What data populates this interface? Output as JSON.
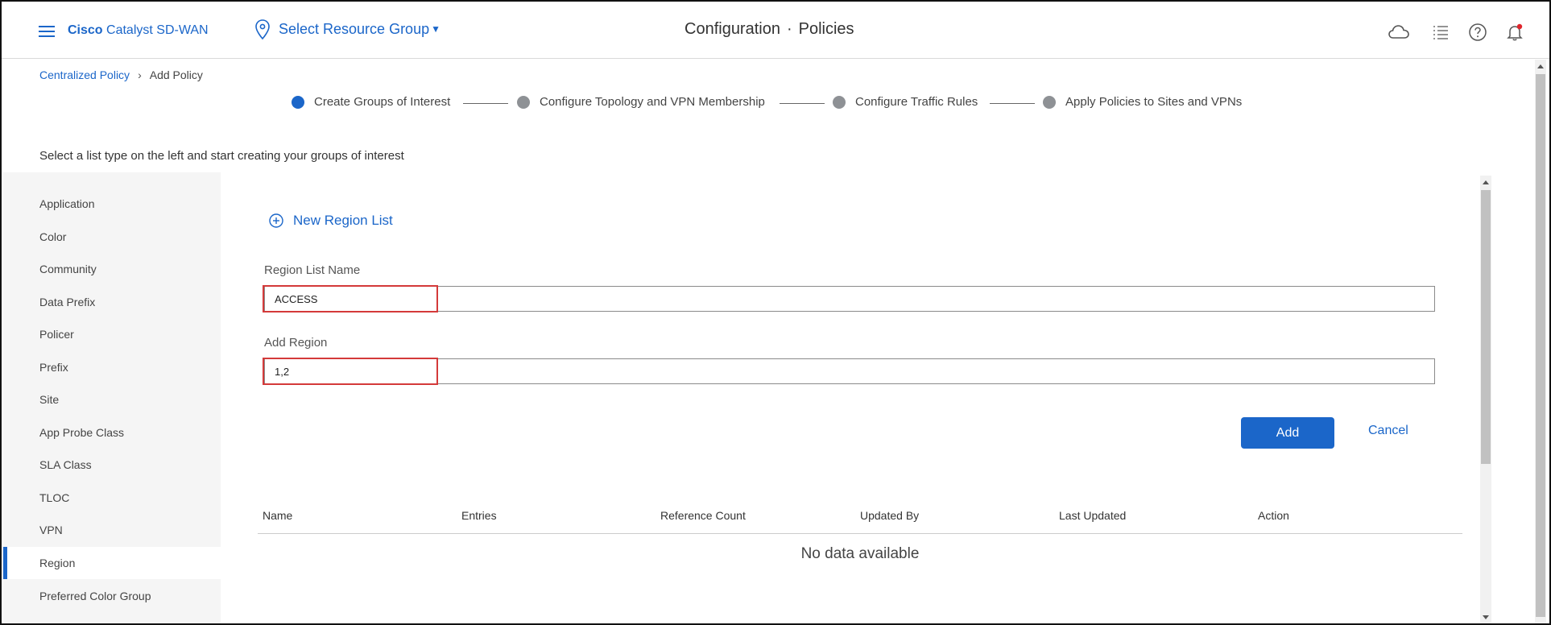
{
  "header": {
    "brand_bold": "Cisco",
    "brand_rest": " Catalyst SD-WAN",
    "resource_group": "Select Resource Group",
    "title_part1": "Configuration",
    "title_sep": "·",
    "title_part2": "Policies"
  },
  "breadcrumb": {
    "parent": "Centralized Policy",
    "current": "Add Policy"
  },
  "steps": [
    {
      "label": "Create Groups of Interest",
      "state": "active"
    },
    {
      "label": "Configure Topology and VPN Membership",
      "state": "inactive"
    },
    {
      "label": "Configure Traffic Rules",
      "state": "inactive"
    },
    {
      "label": "Apply Policies to Sites and VPNs",
      "state": "inactive"
    }
  ],
  "instructions": "Select a list type on the left and start creating your groups of interest",
  "sidebar": {
    "items": [
      {
        "label": "Application"
      },
      {
        "label": "Color"
      },
      {
        "label": "Community"
      },
      {
        "label": "Data Prefix"
      },
      {
        "label": "Policer"
      },
      {
        "label": "Prefix"
      },
      {
        "label": "Site"
      },
      {
        "label": "App Probe Class"
      },
      {
        "label": "SLA Class"
      },
      {
        "label": "TLOC"
      },
      {
        "label": "VPN"
      },
      {
        "label": "Region"
      },
      {
        "label": "Preferred Color Group"
      }
    ],
    "active": "Region"
  },
  "form": {
    "new_list_label": "New Region List",
    "name_label": "Region List Name",
    "name_value": "ACCESS",
    "region_label": "Add Region",
    "region_value": "1,2",
    "add_label": "Add",
    "cancel_label": "Cancel"
  },
  "table": {
    "columns": [
      "Name",
      "Entries",
      "Reference Count",
      "Updated By",
      "Last Updated",
      "Action"
    ],
    "empty_text": "No data available"
  },
  "colors": {
    "accent": "#1b66c9",
    "highlight": "#d43a3a",
    "inactive_step": "#8e9195"
  },
  "icons": {
    "menu": "hamburger-icon",
    "location": "map-pin-icon",
    "cloud": "cloud-icon",
    "list": "list-icon",
    "help": "help-icon",
    "notifications": "bell-icon",
    "add": "plus-circle-icon"
  }
}
